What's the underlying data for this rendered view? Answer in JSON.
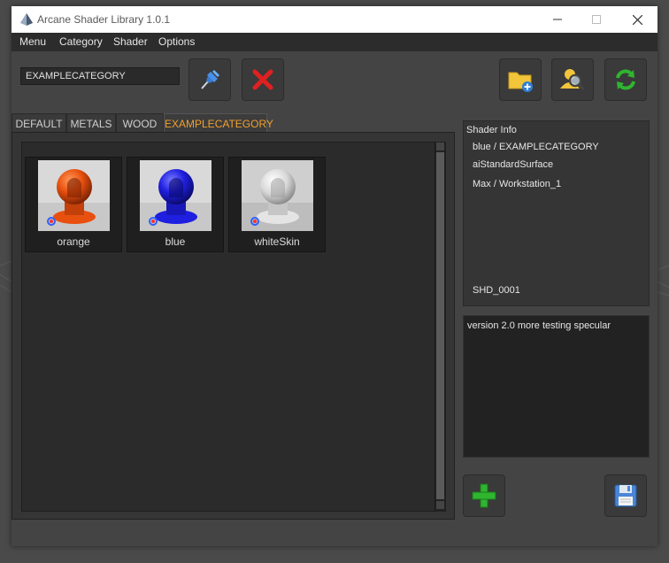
{
  "window": {
    "title": "Arcane Shader Library 1.0.1",
    "controls": {
      "minimize": "—",
      "maximize": "☐",
      "close": "✕"
    }
  },
  "menubar": {
    "items": [
      "Menu",
      "Category",
      "Shader",
      "Options"
    ]
  },
  "toolbar": {
    "search_value": "EXAMPLECATEGORY",
    "buttons": [
      "pin-icon",
      "delete-icon",
      "add-folder-icon",
      "search-user-icon",
      "refresh-icon"
    ]
  },
  "tabs": [
    {
      "label": "DEFAULT",
      "active": false
    },
    {
      "label": "METALS",
      "active": false
    },
    {
      "label": "WOOD",
      "active": false
    },
    {
      "label": "EXAMPLECATEGORY",
      "active": true
    }
  ],
  "shaders": [
    {
      "name": "orange",
      "color": "#e8500f"
    },
    {
      "name": "blue",
      "color": "#1f1fe0"
    },
    {
      "name": "whiteSkin",
      "color": "#d8d8d8"
    }
  ],
  "info": {
    "heading": "Shader Info",
    "path": "blue / EXAMPLECATEGORY",
    "material": "aiStandardSurface",
    "host": "Max / Workstation_1",
    "id": "SHD_0001"
  },
  "notes": "version 2.0 more testing specular",
  "colors": {
    "accent_tab": "#f0a030",
    "add_green": "#2fb52f",
    "delete_red": "#e02020"
  }
}
